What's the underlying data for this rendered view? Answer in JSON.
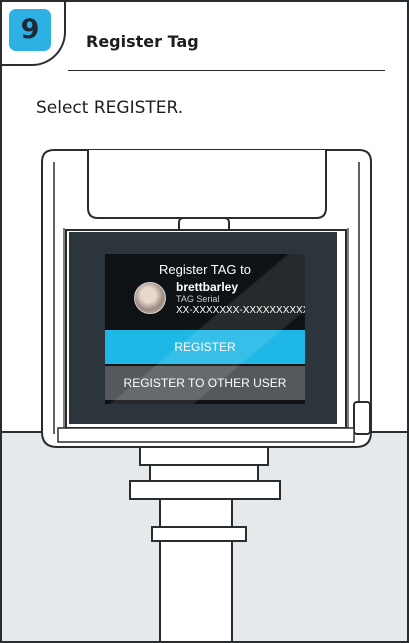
{
  "step": {
    "number": "9",
    "title": "Register Tag",
    "instruction": "Select REGISTER."
  },
  "device_screen": {
    "heading": "Register TAG to",
    "user_name": "brettbarley",
    "serial_label": "TAG Serial",
    "serial_value": "XX-XXXXXXX-XXXXXXXXXX",
    "register_button": "REGISTER",
    "register_other_button": "REGISTER TO OTHER USER"
  },
  "colors": {
    "accent": "#2db0e3",
    "register_button": "#1fb8e6",
    "secondary_button": "#55595d",
    "screen_bezel": "#2c353c",
    "floor": "#e6e9eb"
  }
}
